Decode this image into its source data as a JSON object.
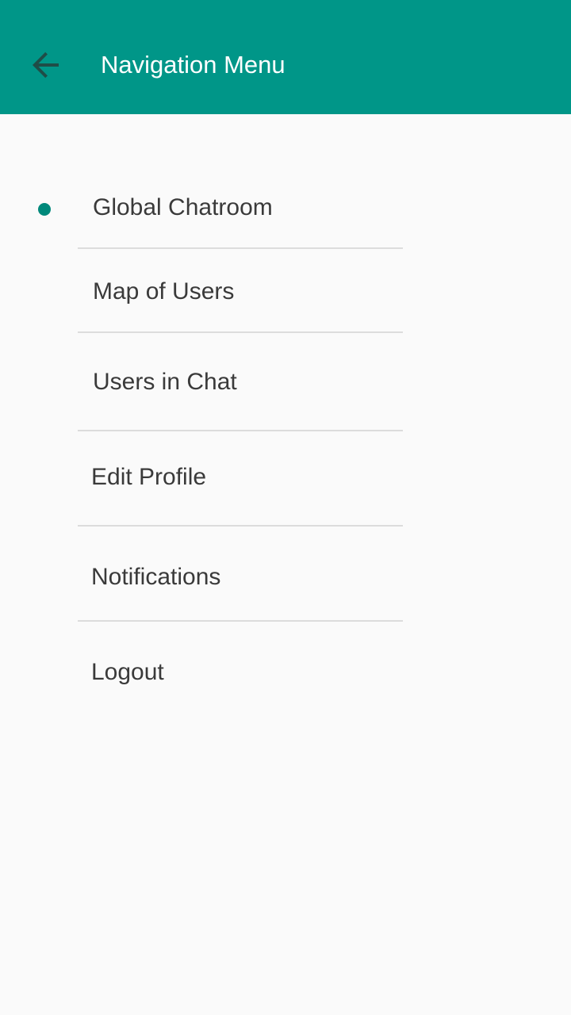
{
  "appbar": {
    "title": "Navigation Menu",
    "back_icon": "arrow-left-icon",
    "background_color": "#009688",
    "icon_color": "#1f4d47"
  },
  "menu": {
    "active_index": 0,
    "active_color": "#00897b",
    "items": [
      {
        "label": "Global Chatroom"
      },
      {
        "label": "Map of Users"
      },
      {
        "label": "Users in Chat"
      },
      {
        "label": "Edit Profile"
      },
      {
        "label": "Notifications"
      },
      {
        "label": "Logout"
      }
    ]
  }
}
